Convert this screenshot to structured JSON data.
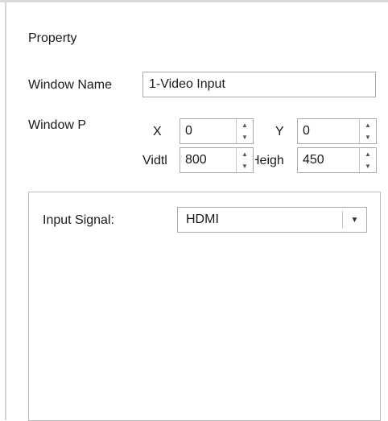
{
  "property": {
    "heading": "Property",
    "window_name": {
      "label": "Window Name",
      "value": "1-Video Input"
    },
    "window_position": {
      "label": "Window P",
      "x": {
        "label": "X",
        "value": "0"
      },
      "y": {
        "label": "Y",
        "value": "0"
      },
      "width": {
        "label": "Vidtl",
        "value": "800"
      },
      "height": {
        "label": "Heigh",
        "value": "450"
      }
    }
  },
  "signal_panel": {
    "input_signal": {
      "label": "Input Signal:",
      "value": "HDMI"
    }
  },
  "icons": {
    "spin_up": "triangle-up",
    "spin_down": "triangle-down",
    "dropdown": "triangle-down"
  }
}
